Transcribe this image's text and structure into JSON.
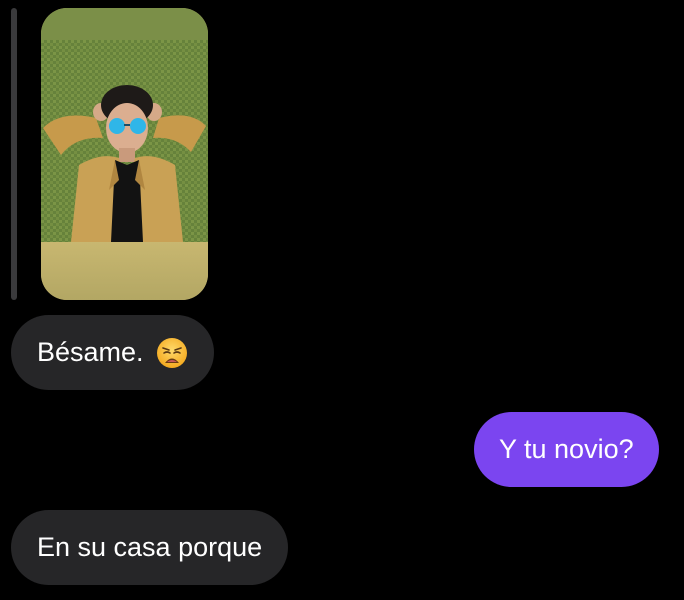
{
  "conversation": {
    "story_reply": {
      "image_description_icon": "story-photo-icon"
    },
    "messages": [
      {
        "direction": "incoming",
        "text": "Bésame.",
        "emoji": "weary-face-icon"
      },
      {
        "direction": "outgoing",
        "text": "Y tu novio?"
      },
      {
        "direction": "incoming",
        "text": "En su casa porque"
      }
    ]
  },
  "colors": {
    "background": "#000000",
    "incoming_bubble": "#262628",
    "outgoing_bubble": "#7b45f0",
    "text": "#ffffff"
  }
}
